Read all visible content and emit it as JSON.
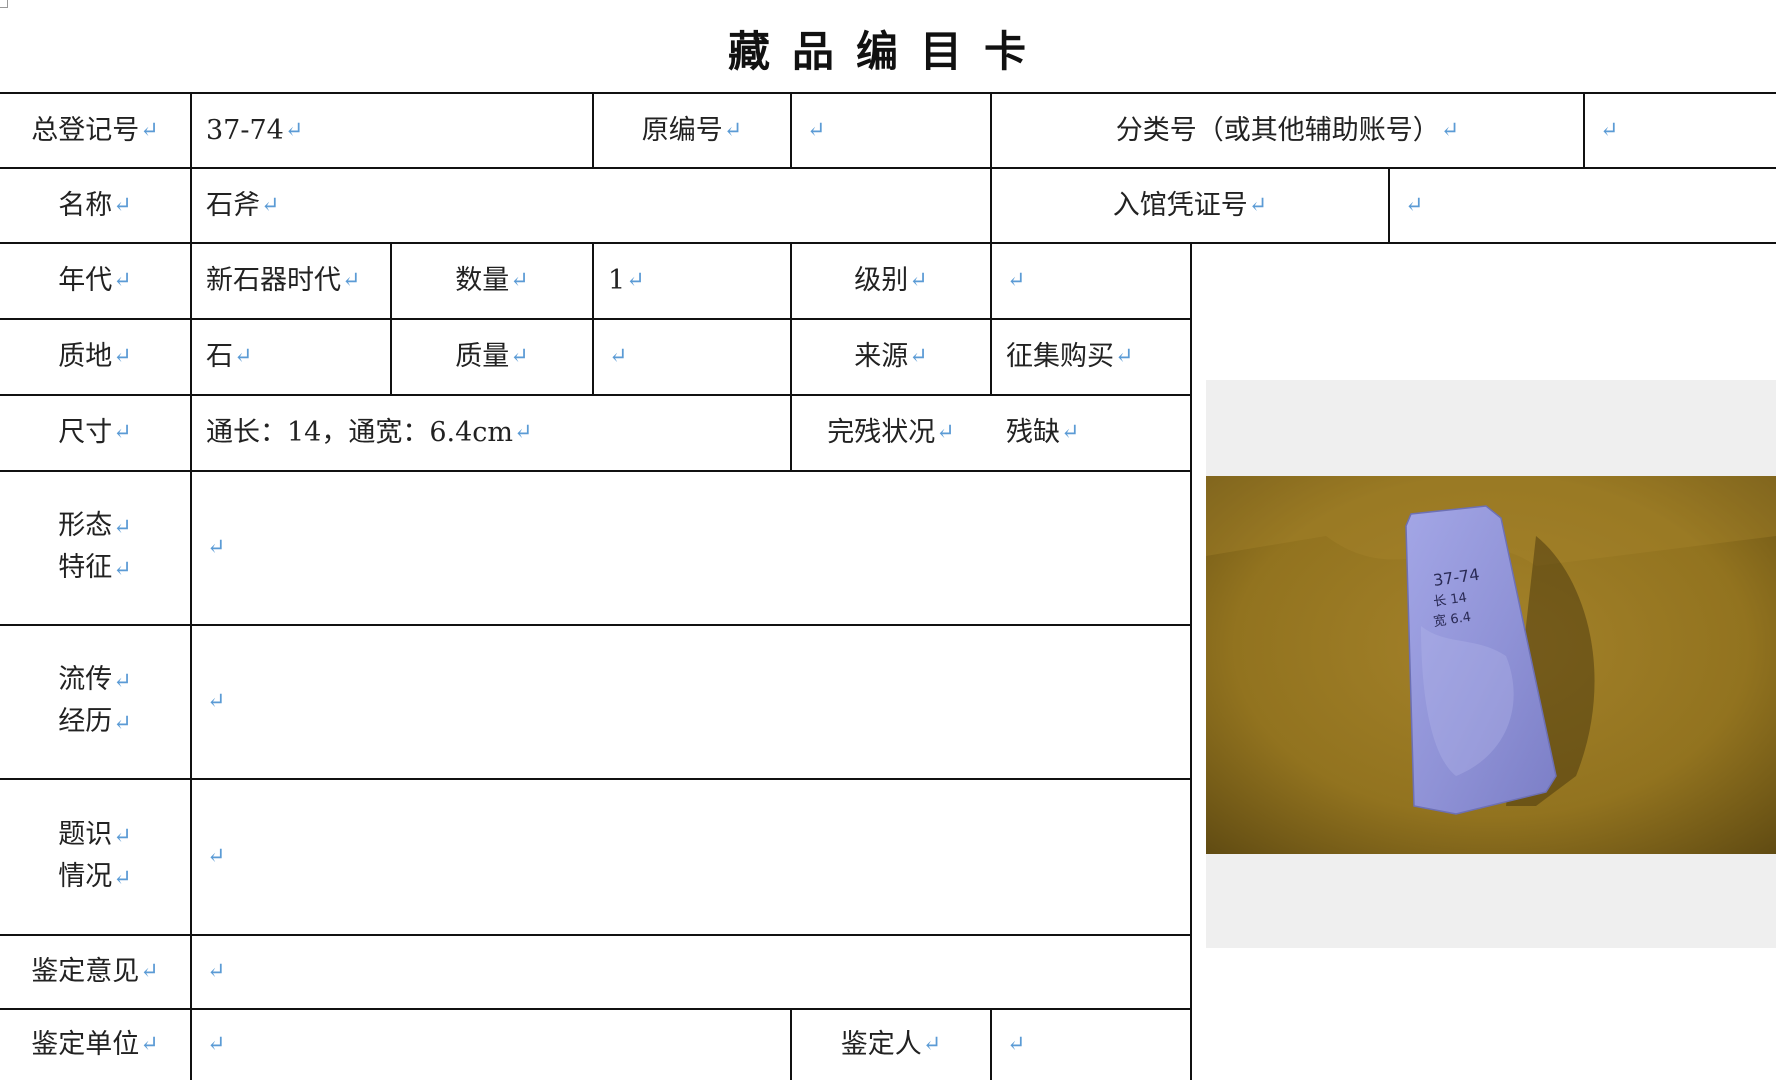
{
  "title": "藏品编目卡",
  "mark": "↵",
  "labels": {
    "registration_no": "总登记号",
    "original_no": "原编号",
    "classification_no": "分类号（或其他辅助账号）",
    "name": "名称",
    "accession_voucher_no": "入馆凭证号",
    "era": "年代",
    "quantity": "数量",
    "grade": "级别",
    "material": "质地",
    "mass": "质量",
    "source": "来源",
    "dimensions": "尺寸",
    "condition": "完残状况",
    "morphology": [
      "形态",
      "特征"
    ],
    "provenance": [
      "流传",
      "经历"
    ],
    "inscriptions": [
      "题识",
      "情况"
    ],
    "appraisal_opinion": "鉴定意见",
    "appraisal_unit": "鉴定单位",
    "appraiser": "鉴定人"
  },
  "values": {
    "registration_no": "37-74",
    "original_no": "",
    "classification_no": "",
    "name": "石斧",
    "accession_voucher_no": "",
    "era": "新石器时代",
    "quantity": "1",
    "grade": "",
    "material": "石",
    "mass": "",
    "source": "征集购买",
    "dimensions": "通长：14，通宽：6.4cm",
    "condition": "残缺",
    "morphology": "",
    "provenance": "",
    "inscriptions": "",
    "appraisal_opinion": "",
    "appraisal_unit": "",
    "appraiser": ""
  },
  "photo": {
    "written_label": "37-74 长 14 宽 6.4",
    "colors": {
      "cloth": "#9c7a22",
      "stone": "#9294d6"
    }
  }
}
